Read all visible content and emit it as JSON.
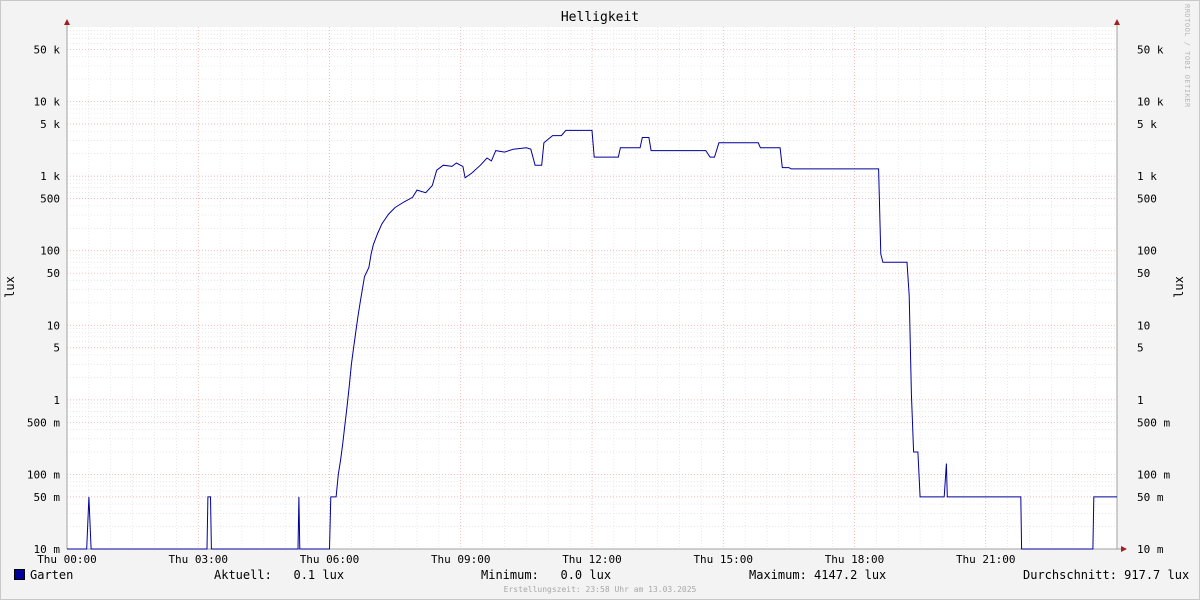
{
  "chart_data": {
    "type": "line",
    "title": "Helligkeit",
    "ylabel": "lux",
    "y_scale": "log",
    "ylim": [
      0.01,
      100000
    ],
    "xlim": [
      0,
      24
    ],
    "x_ticks": [
      {
        "value": 0,
        "label": "Thu 00:00"
      },
      {
        "value": 3,
        "label": "Thu 03:00"
      },
      {
        "value": 6,
        "label": "Thu 06:00"
      },
      {
        "value": 9,
        "label": "Thu 09:00"
      },
      {
        "value": 12,
        "label": "Thu 12:00"
      },
      {
        "value": 15,
        "label": "Thu 15:00"
      },
      {
        "value": 18,
        "label": "Thu 18:00"
      },
      {
        "value": 21,
        "label": "Thu 21:00"
      }
    ],
    "y_ticks": [
      {
        "value": 0.01,
        "label": "10 m"
      },
      {
        "value": 0.05,
        "label": "50 m"
      },
      {
        "value": 0.1,
        "label": "100 m"
      },
      {
        "value": 0.5,
        "label": "500 m"
      },
      {
        "value": 1,
        "label": "1"
      },
      {
        "value": 5,
        "label": "5"
      },
      {
        "value": 10,
        "label": "10"
      },
      {
        "value": 50,
        "label": "50"
      },
      {
        "value": 100,
        "label": "100"
      },
      {
        "value": 500,
        "label": "500"
      },
      {
        "value": 1000,
        "label": "1 k"
      },
      {
        "value": 5000,
        "label": "5 k"
      },
      {
        "value": 10000,
        "label": "10 k"
      },
      {
        "value": 50000,
        "label": "50 k"
      }
    ],
    "grid": true,
    "series": [
      {
        "name": "Garten",
        "color": "#00009c",
        "points": [
          [
            0.0,
            0.01
          ],
          [
            0.45,
            0.01
          ],
          [
            0.5,
            0.05
          ],
          [
            0.55,
            0.01
          ],
          [
            3.2,
            0.01
          ],
          [
            3.22,
            0.05
          ],
          [
            3.28,
            0.05
          ],
          [
            3.3,
            0.01
          ],
          [
            5.28,
            0.01
          ],
          [
            5.3,
            0.05
          ],
          [
            5.32,
            0.01
          ],
          [
            6.0,
            0.01
          ],
          [
            6.03,
            0.05
          ],
          [
            6.15,
            0.05
          ],
          [
            6.2,
            0.1
          ],
          [
            6.25,
            0.15
          ],
          [
            6.3,
            0.25
          ],
          [
            6.35,
            0.45
          ],
          [
            6.4,
            0.8
          ],
          [
            6.45,
            1.5
          ],
          [
            6.5,
            3
          ],
          [
            6.55,
            5
          ],
          [
            6.6,
            8
          ],
          [
            6.65,
            13
          ],
          [
            6.7,
            20
          ],
          [
            6.75,
            30
          ],
          [
            6.8,
            45
          ],
          [
            6.9,
            60
          ],
          [
            6.95,
            90
          ],
          [
            7.0,
            120
          ],
          [
            7.1,
            170
          ],
          [
            7.2,
            230
          ],
          [
            7.35,
            310
          ],
          [
            7.5,
            380
          ],
          [
            7.7,
            450
          ],
          [
            7.9,
            520
          ],
          [
            8.0,
            650
          ],
          [
            8.2,
            600
          ],
          [
            8.35,
            750
          ],
          [
            8.45,
            1200
          ],
          [
            8.6,
            1400
          ],
          [
            8.8,
            1350
          ],
          [
            8.9,
            1500
          ],
          [
            9.05,
            1350
          ],
          [
            9.1,
            950
          ],
          [
            9.25,
            1100
          ],
          [
            9.45,
            1400
          ],
          [
            9.6,
            1750
          ],
          [
            9.7,
            1600
          ],
          [
            9.8,
            2200
          ],
          [
            10.0,
            2100
          ],
          [
            10.2,
            2300
          ],
          [
            10.5,
            2400
          ],
          [
            10.6,
            2300
          ],
          [
            10.7,
            1400
          ],
          [
            10.85,
            1400
          ],
          [
            10.9,
            2800
          ],
          [
            11.1,
            3500
          ],
          [
            11.3,
            3500
          ],
          [
            11.4,
            4100
          ],
          [
            12.0,
            4100
          ],
          [
            12.05,
            1800
          ],
          [
            12.6,
            1800
          ],
          [
            12.65,
            2400
          ],
          [
            13.1,
            2400
          ],
          [
            13.15,
            3300
          ],
          [
            13.3,
            3300
          ],
          [
            13.35,
            2200
          ],
          [
            14.6,
            2200
          ],
          [
            14.7,
            1800
          ],
          [
            14.8,
            1800
          ],
          [
            14.9,
            2800
          ],
          [
            15.8,
            2800
          ],
          [
            15.85,
            2400
          ],
          [
            16.3,
            2400
          ],
          [
            16.35,
            1300
          ],
          [
            16.5,
            1300
          ],
          [
            16.55,
            1250
          ],
          [
            18.55,
            1250
          ],
          [
            18.6,
            90
          ],
          [
            18.65,
            70
          ],
          [
            19.2,
            70
          ],
          [
            19.25,
            25
          ],
          [
            19.3,
            1.2
          ],
          [
            19.35,
            0.2
          ],
          [
            19.45,
            0.2
          ],
          [
            19.5,
            0.05
          ],
          [
            20.05,
            0.05
          ],
          [
            20.1,
            0.14
          ],
          [
            20.12,
            0.05
          ],
          [
            21.8,
            0.05
          ],
          [
            21.82,
            0.01
          ],
          [
            23.45,
            0.01
          ],
          [
            23.47,
            0.05
          ],
          [
            24.0,
            0.05
          ]
        ]
      }
    ]
  },
  "legend": {
    "series_name": "Garten",
    "current": "Aktuell:   0.1 lux",
    "minimum": "Minimum:   0.0 lux",
    "maximum": "Maximum: 4147.2 lux",
    "average": "Durchschnitt: 917.7 lux"
  },
  "watermark": "RRDTOOL / TOBI OETIKER",
  "footer": "Erstellungszeit: 23:58 Uhr am 13.03.2025"
}
